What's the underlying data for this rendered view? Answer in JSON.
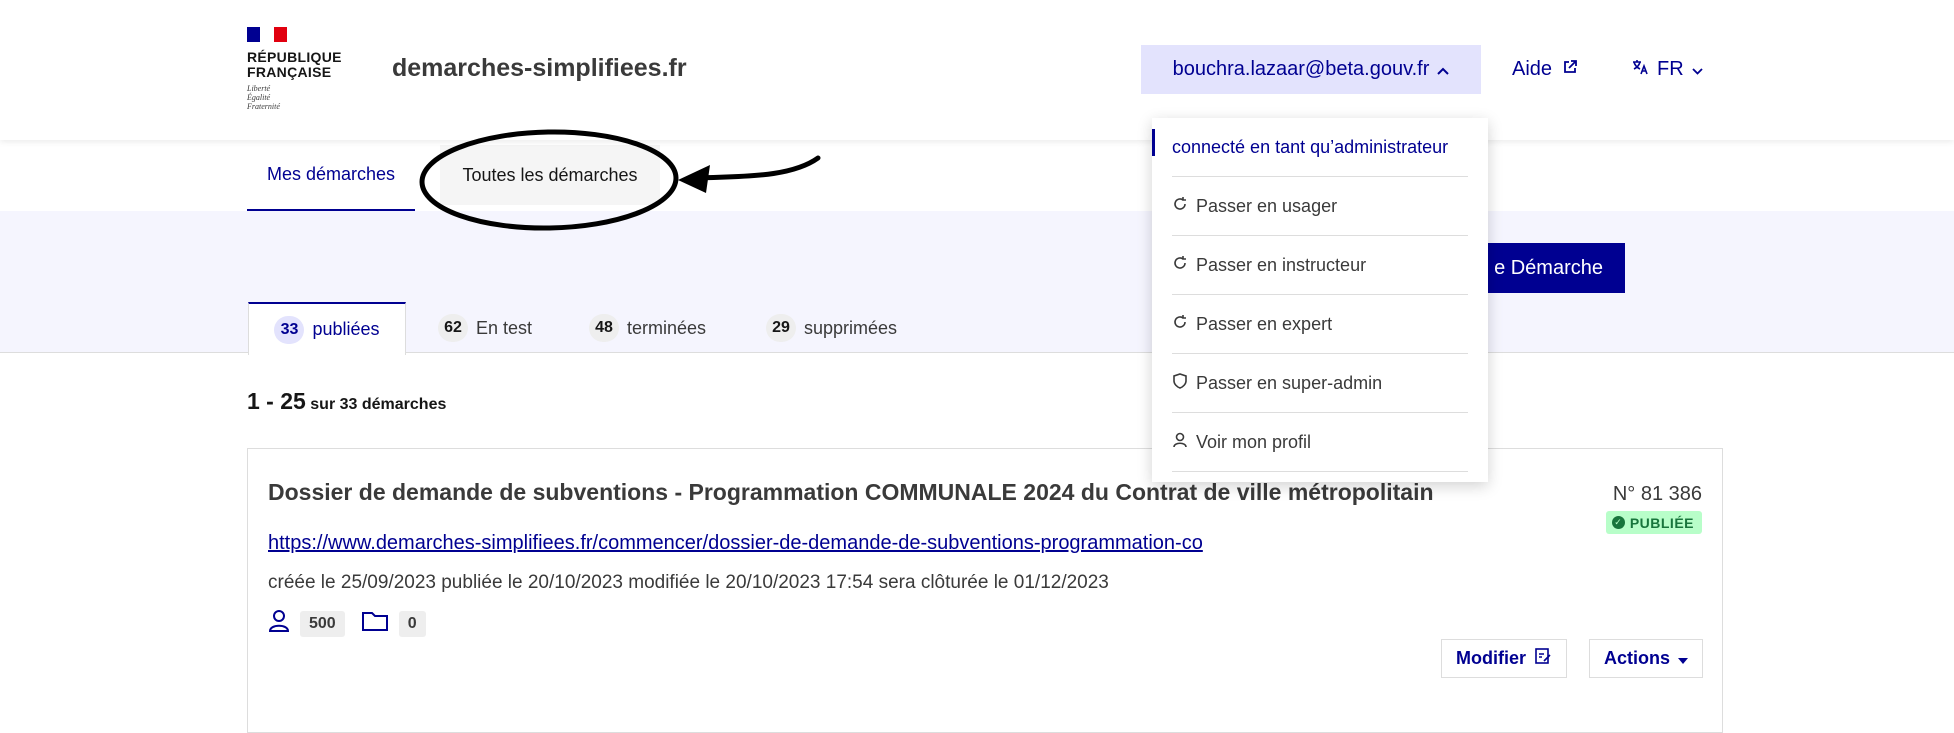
{
  "header": {
    "logo_title_line1": "RÉPUBLIQUE",
    "logo_title_line2": "FRANÇAISE",
    "logo_motto_1": "Liberté",
    "logo_motto_2": "Égalité",
    "logo_motto_3": "Fraternité",
    "site_name": "demarches-simplifiees.fr",
    "user_email": "bouchra.lazaar@beta.gouv.fr",
    "aide_label": "Aide",
    "lang_label": "FR"
  },
  "nav": {
    "tab_mine": "Mes démarches",
    "tab_all": "Toutes les démarches"
  },
  "toolbar": {
    "new_button": "e Démarche"
  },
  "status_tabs": [
    {
      "count": "33",
      "label": "publiées"
    },
    {
      "count": "62",
      "label": "En test"
    },
    {
      "count": "48",
      "label": "terminées"
    },
    {
      "count": "29",
      "label": "supprimées"
    }
  ],
  "pagination": {
    "range": "1 - 25",
    "total": "sur 33 démarches"
  },
  "card": {
    "title": "Dossier de demande de subventions - Programmation COMMUNALE 2024 du Contrat de ville métropolitain",
    "number": "N° 81 386",
    "status": "PUBLIÉE",
    "url": "https://www.demarches-simplifiees.fr/commencer/dossier-de-demande-de-subventions-programmation-co",
    "dates": "créée le 25/09/2023 publiée le 20/10/2023 modifiée le 20/10/2023 17:54 sera clôturée le 01/12/2023",
    "users_count": "500",
    "files_count": "0",
    "modify_label": "Modifier",
    "actions_label": "Actions"
  },
  "dropdown": {
    "header": "connecté en tant qu’administrateur",
    "items": [
      {
        "label": "Passer en usager",
        "icon": "refresh-icon"
      },
      {
        "label": "Passer en instructeur",
        "icon": "refresh-icon"
      },
      {
        "label": "Passer en expert",
        "icon": "refresh-icon"
      },
      {
        "label": "Passer en super-admin",
        "icon": "shield-icon"
      },
      {
        "label": "Voir mon profil",
        "icon": "user-icon"
      }
    ]
  },
  "colors": {
    "brand_blue": "#000091",
    "marianne_red": "#e1000f",
    "published_green": "#18753c"
  }
}
